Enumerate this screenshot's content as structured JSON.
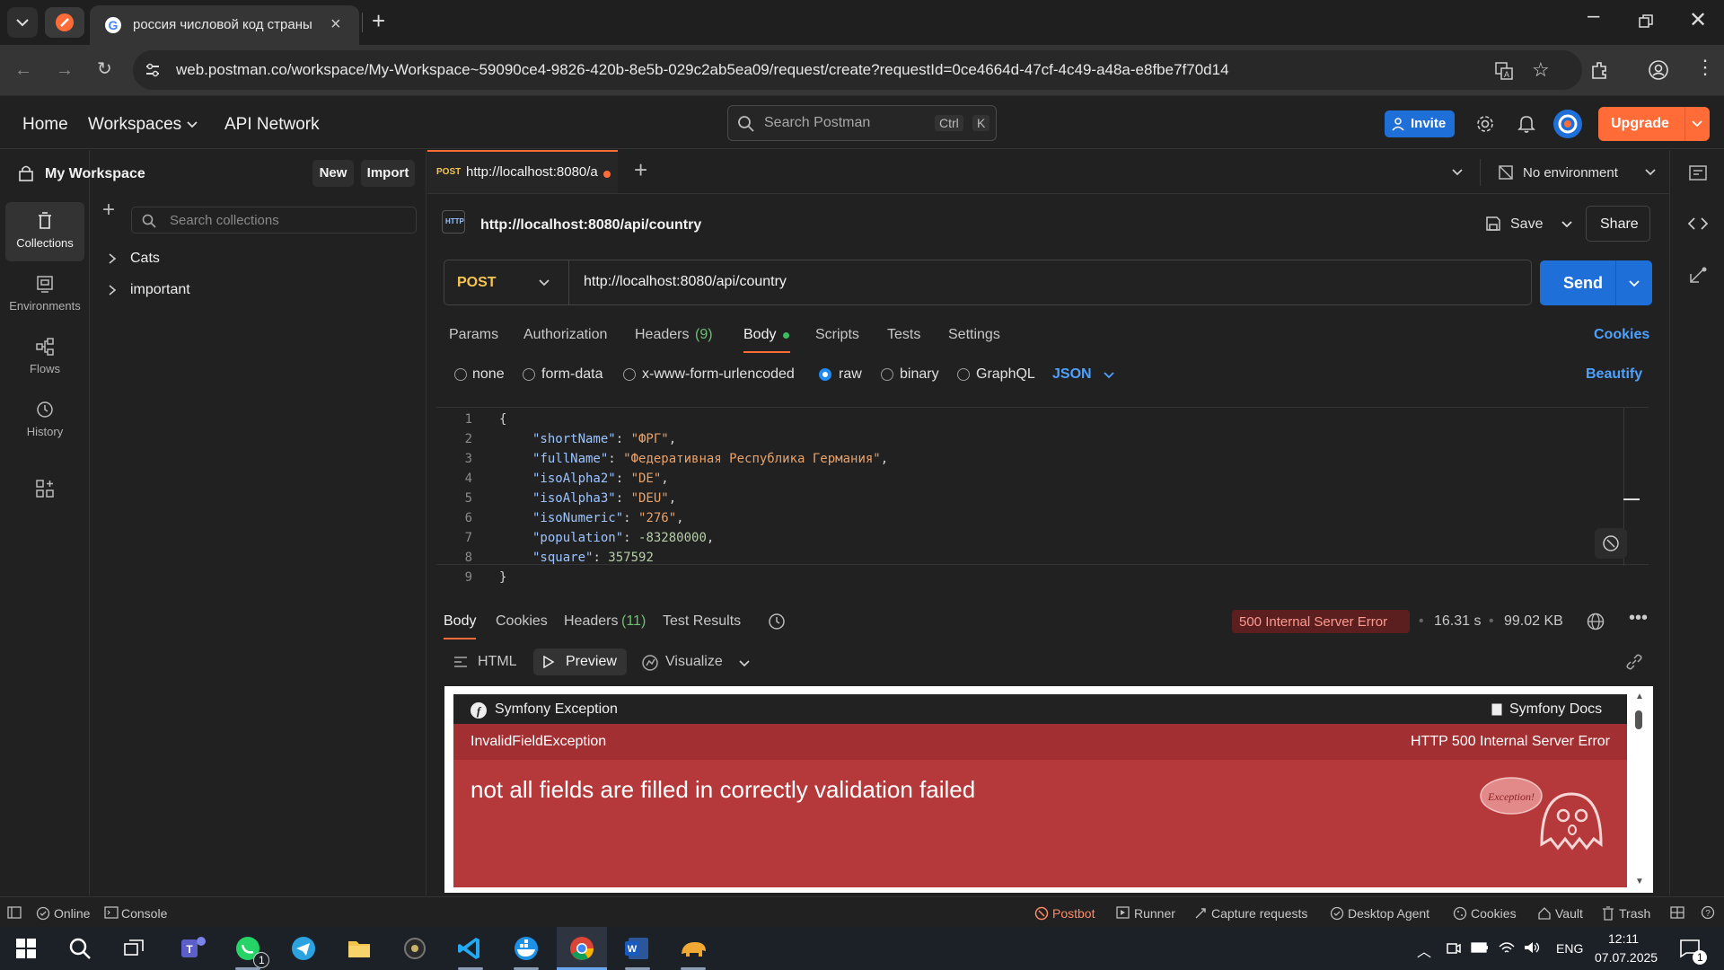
{
  "browser": {
    "tab_title": "россия числовой код страны",
    "url": "web.postman.co/workspace/My-Workspace~59090ce4-9826-420b-8e5b-029c2ab5ea09/request/create?requestId=0ce4664d-47cf-4c49-a48a-e8fbe7f70d14"
  },
  "header": {
    "nav": [
      "Home",
      "Workspaces",
      "API Network"
    ],
    "search_placeholder": "Search Postman",
    "kbd_ctrl": "Ctrl",
    "kbd_k": "K",
    "invite": "Invite",
    "upgrade": "Upgrade"
  },
  "workspace": {
    "title": "My Workspace",
    "new_label": "New",
    "import_label": "Import",
    "search_placeholder": "Search collections",
    "collections": [
      "Cats",
      "important"
    ]
  },
  "rail": {
    "items": [
      "Collections",
      "Environments",
      "Flows",
      "History"
    ]
  },
  "request_tab": {
    "method": "POST",
    "label": "http://localhost:8080/a",
    "environment": "No environment"
  },
  "request": {
    "name": "http://localhost:8080/api/country",
    "save": "Save",
    "share": "Share",
    "method": "POST",
    "url": "http://localhost:8080/api/country",
    "send": "Send",
    "tabs": [
      "Params",
      "Authorization",
      "Headers",
      "Body",
      "Scripts",
      "Tests",
      "Settings"
    ],
    "headers_count": "(9)",
    "cookies": "Cookies",
    "body_types": [
      "none",
      "form-data",
      "x-www-form-urlencoded",
      "raw",
      "binary",
      "GraphQL"
    ],
    "body_format": "JSON",
    "beautify": "Beautify",
    "http_badge": "HTTP"
  },
  "code": {
    "line_numbers": [
      "1",
      "2",
      "3",
      "4",
      "5",
      "6",
      "7",
      "8",
      "9"
    ],
    "open_brace": "{",
    "close_brace": "}",
    "k_shortName": "\"shortName\"",
    "v_shortName": "\"ФРГ\"",
    "k_fullName": "\"fullName\"",
    "v_fullName": "\"Федеративная Республика Германия\"",
    "k_isoAlpha2": "\"isoAlpha2\"",
    "v_isoAlpha2": "\"DE\"",
    "k_isoAlpha3": "\"isoAlpha3\"",
    "v_isoAlpha3": "\"DEU\"",
    "k_isoNumeric": "\"isoNumeric\"",
    "v_isoNumeric": "\"276\"",
    "k_population": "\"population\"",
    "v_population": "-83280000",
    "k_square": "\"square\"",
    "v_square": "357592",
    "colon": ": ",
    "comma": ","
  },
  "response": {
    "tabs": [
      "Body",
      "Cookies",
      "Headers",
      "Test Results"
    ],
    "headers_count": "(11)",
    "status": "500 Internal Server Error",
    "time": "16.31 s",
    "size": "99.02 KB",
    "view_modes": [
      "HTML",
      "Preview",
      "Visualize"
    ],
    "preview": {
      "brand": "Symfony Exception",
      "docs": "Symfony Docs",
      "exception_class": "InvalidFieldException",
      "http_status": "HTTP 500 Internal Server Error",
      "message": "not all fields are filled in correctly validation failed",
      "ghost_label": "Exception!"
    }
  },
  "statusbar": {
    "online": "Online",
    "console": "Console",
    "postbot": "Postbot",
    "runner": "Runner",
    "capture": "Capture requests",
    "desktop_agent": "Desktop Agent",
    "cookies": "Cookies",
    "vault": "Vault",
    "trash": "Trash"
  },
  "taskbar": {
    "lang": "ENG",
    "time": "12:11",
    "date": "07.07.2025",
    "whatsapp_badge": "1",
    "notif_badge": "1"
  },
  "colors": {
    "accent_orange": "#ff6c37",
    "accent_blue": "#1f6fd9",
    "error_red": "#b5393b",
    "post_yellow": "#f5c451"
  }
}
